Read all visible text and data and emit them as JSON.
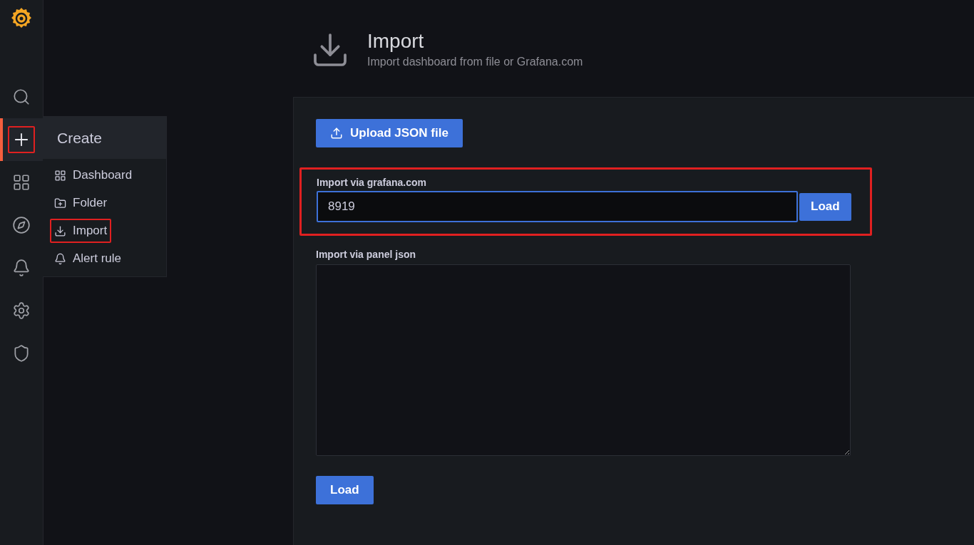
{
  "sidebar": {
    "items": [
      {
        "kind": "search",
        "selected": false,
        "highlighted": false
      },
      {
        "kind": "create",
        "selected": true,
        "highlighted": true
      },
      {
        "kind": "dashboards",
        "selected": false,
        "highlighted": false
      },
      {
        "kind": "explore",
        "selected": false,
        "highlighted": false
      },
      {
        "kind": "alerting",
        "selected": false,
        "highlighted": false
      },
      {
        "kind": "configuration",
        "selected": false,
        "highlighted": false
      },
      {
        "kind": "shield",
        "selected": false,
        "highlighted": false
      }
    ]
  },
  "flyout": {
    "title": "Create",
    "items": [
      {
        "kind": "dashboard",
        "label": "Dashboard",
        "highlighted": false
      },
      {
        "kind": "folder",
        "label": "Folder",
        "highlighted": false
      },
      {
        "kind": "import",
        "label": "Import",
        "highlighted": true
      },
      {
        "kind": "alert",
        "label": "Alert rule",
        "highlighted": false
      }
    ]
  },
  "header": {
    "title": "Import",
    "subtitle": "Import dashboard from file or Grafana.com"
  },
  "upload_button": "Upload JSON file",
  "grafana_section": {
    "label": "Import via grafana.com",
    "value": "8919",
    "button": "Load",
    "highlighted": true
  },
  "panel_json_section": {
    "label": "Import via panel json",
    "button": "Load"
  }
}
